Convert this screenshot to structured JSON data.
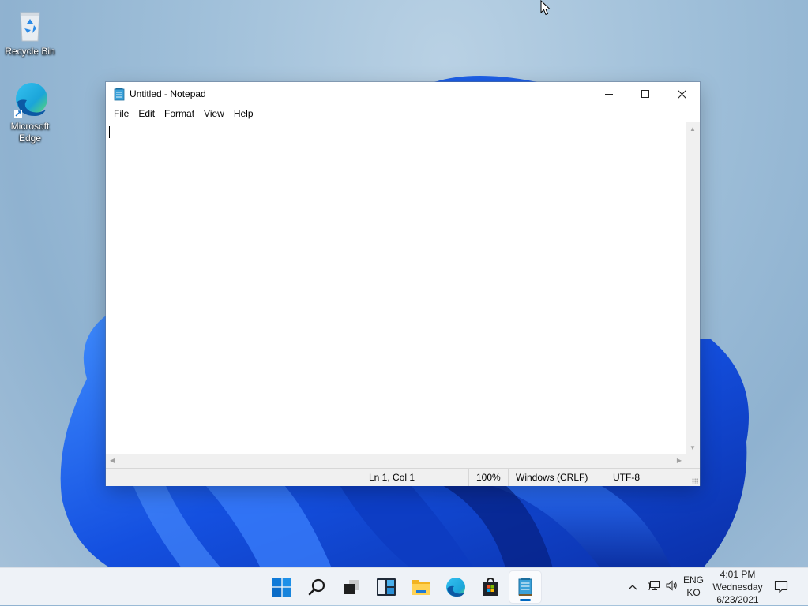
{
  "desktop": {
    "icons": [
      {
        "label": "Recycle Bin",
        "icon": "recycle-bin-icon"
      },
      {
        "label_line1": "Microsoft",
        "label_line2": "Edge",
        "icon": "edge-icon"
      }
    ]
  },
  "notepad": {
    "title": "Untitled - Notepad",
    "caption": {
      "minimize": "─",
      "maximize": "☐",
      "close": "✕"
    },
    "menu": [
      "File",
      "Edit",
      "Format",
      "View",
      "Help"
    ],
    "content": "",
    "status": {
      "position": "Ln 1, Col 1",
      "zoom": "100%",
      "line_ending": "Windows (CRLF)",
      "encoding": "UTF-8"
    }
  },
  "taskbar": {
    "apps": [
      "start-icon",
      "search-icon",
      "task-view-icon",
      "widgets-icon",
      "file-explorer-icon",
      "edge-icon",
      "store-icon",
      "notepad-icon"
    ],
    "active_app": "notepad-icon",
    "tray": {
      "chevron": "^",
      "language_line1": "ENG",
      "language_line2": "KO",
      "time": "4:01 PM",
      "day": "Wednesday",
      "date": "6/23/2021"
    },
    "accent": "#0067c0"
  }
}
